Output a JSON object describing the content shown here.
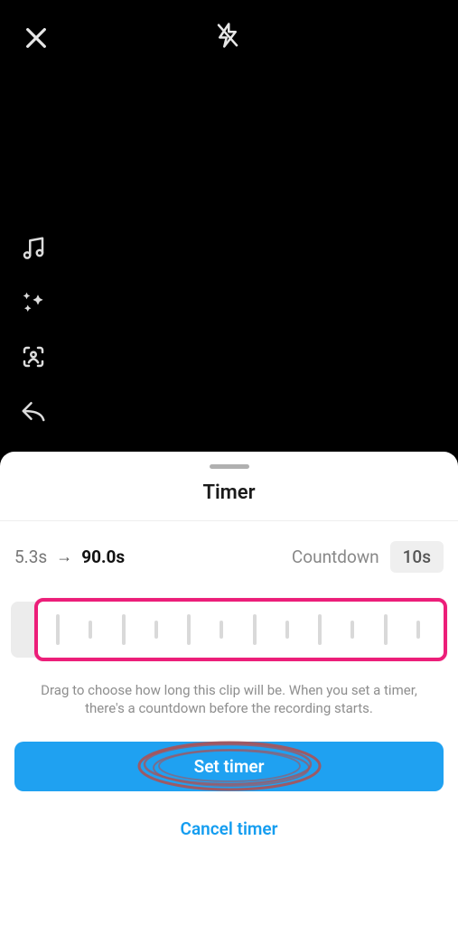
{
  "sheet": {
    "title": "Timer",
    "time_from": "5.3s",
    "time_to": "90.0s",
    "countdown_label": "Countdown",
    "countdown_value": "10s",
    "helper_text": "Drag to choose how long this clip will be. When you set a timer, there's a countdown before the recording starts.",
    "set_button_label": "Set timer",
    "cancel_button_label": "Cancel timer",
    "accent_color": "#ec1e79",
    "primary_color": "#1fa1f1"
  },
  "icons": {
    "close": "close-icon",
    "flash_off": "flash-off-icon",
    "music": "music-icon",
    "sparkle": "sparkle-icon",
    "face_filter": "face-filter-icon",
    "reply": "reply-icon"
  }
}
